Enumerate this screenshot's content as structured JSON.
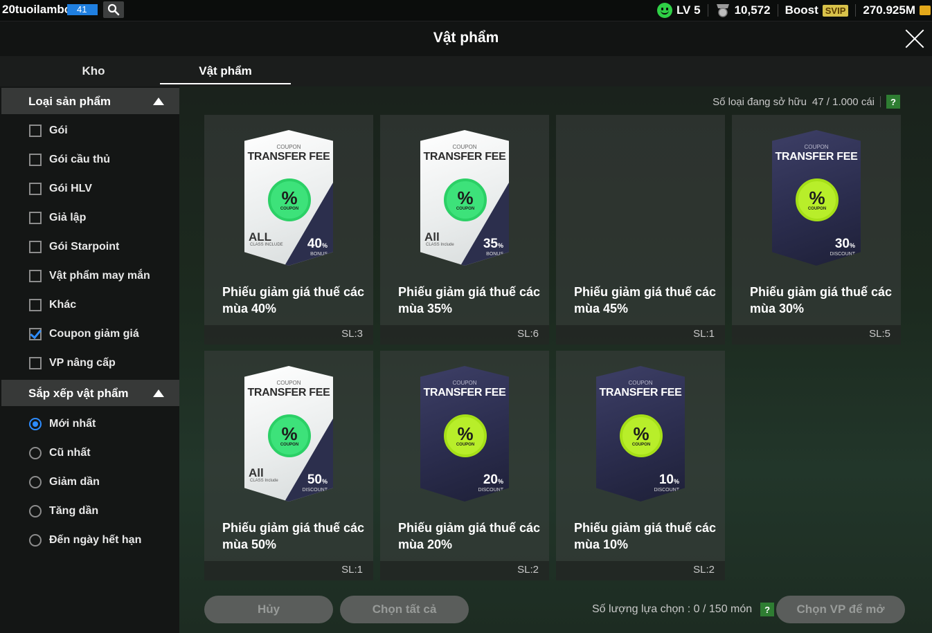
{
  "topbar": {
    "username": "20tuoilambo",
    "level_badge": "41",
    "lv": "LV 5",
    "points": "10,572",
    "boost": "Boost",
    "svip": "SVIP",
    "balance": "270.925M"
  },
  "window": {
    "title": "Vật phẩm"
  },
  "tabs": [
    {
      "label": "Kho"
    },
    {
      "label": "Vật phẩm",
      "active": true
    }
  ],
  "sidebar": {
    "category_title": "Loại sản phẩm",
    "categories": [
      {
        "label": "Gói",
        "checked": false
      },
      {
        "label": "Gói cầu thủ",
        "checked": false
      },
      {
        "label": "Gói HLV",
        "checked": false
      },
      {
        "label": "Giả lập",
        "checked": false
      },
      {
        "label": "Gói Starpoint",
        "checked": false
      },
      {
        "label": "Vật phẩm may mắn",
        "checked": false
      },
      {
        "label": "Khác",
        "checked": false
      },
      {
        "label": "Coupon giảm giá",
        "checked": true
      },
      {
        "label": "VP nâng cấp",
        "checked": false
      }
    ],
    "sort_title": "Sắp xếp vật phẩm",
    "sorts": [
      {
        "label": "Mới nhất",
        "selected": true
      },
      {
        "label": "Cũ nhất",
        "selected": false
      },
      {
        "label": "Giảm dần",
        "selected": false
      },
      {
        "label": "Tăng dần",
        "selected": false
      },
      {
        "label": "Đến ngày hết hạn",
        "selected": false
      }
    ]
  },
  "main": {
    "owned_label": "Số loại đang sở hữu",
    "owned_value": "47 / 1.000 cái",
    "help": "?",
    "items": [
      {
        "name": "Phiếu giảm giá thuế các mùa 40%",
        "qty": "SL:3",
        "style": "white",
        "badge": "green",
        "coupon": "COUPON",
        "ticket_title": "TRANSFER FEE",
        "pct_symbol": "%",
        "badge_label": "COUPON",
        "all": "ALL",
        "all_sub": "CLASS INCLUDE",
        "value": "40",
        "value_unit": "%",
        "value_label": "BONUS"
      },
      {
        "name": "Phiếu giảm giá thuế các mùa 35%",
        "qty": "SL:6",
        "style": "white",
        "badge": "green",
        "coupon": "COUPON",
        "ticket_title": "TRANSFER FEE",
        "pct_symbol": "%",
        "badge_label": "COUPON",
        "all": "All",
        "all_sub": "CLASS Include",
        "value": "35",
        "value_unit": "%",
        "value_label": "BONUS"
      },
      {
        "name": "Phiếu giảm giá thuế các mùa 45%",
        "qty": "SL:1",
        "style": "none",
        "badge": "",
        "coupon": "",
        "ticket_title": "",
        "pct_symbol": "",
        "badge_label": "",
        "all": "",
        "all_sub": "",
        "value": "",
        "value_unit": "",
        "value_label": ""
      },
      {
        "name": "Phiếu giảm giá thuế các mùa 30%",
        "qty": "SL:5",
        "style": "dark",
        "badge": "lime",
        "coupon": "COUPON",
        "ticket_title": "TRANSFER FEE",
        "pct_symbol": "%",
        "badge_label": "COUPON",
        "all": "",
        "all_sub": "",
        "value": "30",
        "value_unit": "%",
        "value_label": "DISCOUNT"
      },
      {
        "name": "Phiếu giảm giá thuế các mùa 50%",
        "qty": "SL:1",
        "style": "white",
        "badge": "green",
        "coupon": "COUPON",
        "ticket_title": "TRANSFER FEE",
        "pct_symbol": "%",
        "badge_label": "COUPON",
        "all": "All",
        "all_sub": "CLASS Include",
        "value": "50",
        "value_unit": "%",
        "value_label": "DISCOUNT"
      },
      {
        "name": "Phiếu giảm giá thuế các mùa 20%",
        "qty": "SL:2",
        "style": "dark",
        "badge": "lime",
        "coupon": "COUPON",
        "ticket_title": "TRANSFER FEE",
        "pct_symbol": "%",
        "badge_label": "COUPON",
        "all": "",
        "all_sub": "",
        "value": "20",
        "value_unit": "%",
        "value_label": "DISCOUNT"
      },
      {
        "name": "Phiếu giảm giá thuế các mùa 10%",
        "qty": "SL:2",
        "style": "dark",
        "badge": "lime",
        "coupon": "COUPON",
        "ticket_title": "TRANSFER FEE",
        "pct_symbol": "%",
        "badge_label": "COUPON",
        "all": "",
        "all_sub": "",
        "value": "10",
        "value_unit": "%",
        "value_label": "DISCOUNT"
      }
    ]
  },
  "footer": {
    "cancel": "Hủy",
    "select_all": "Chọn tất cả",
    "selection_label": "Số lượng lựa chọn : 0 / 150 món",
    "help": "?",
    "open": "Chọn VP để mở"
  },
  "icons": {
    "search": "search-icon",
    "close": "close-icon",
    "smile": "smile-icon",
    "medal": "medal-icon",
    "coins": "coins-icon"
  },
  "colors": {
    "level_badge": "#1f7fe0",
    "checked": "#2d8cff",
    "smile": "#2fd046",
    "svip": "#d8c24a",
    "help_green": "#2e7d32"
  }
}
